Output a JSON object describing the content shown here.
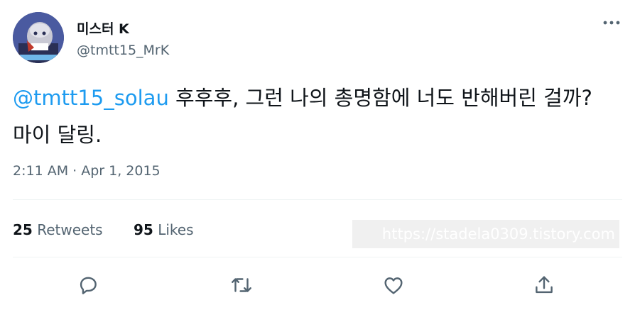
{
  "user": {
    "display_name": "미스터 K",
    "handle": "@tmtt15_MrK",
    "avatar_icon": "avatar-image"
  },
  "tweet": {
    "mention": "@tmtt15_solau",
    "text": " 후후후, 그런 나의 총명함에 너도 반해버린 걸까? 마이 달링.",
    "timestamp": "2:11 AM · Apr 1, 2015"
  },
  "stats": {
    "retweets_count": "25",
    "retweets_label": "Retweets",
    "likes_count": "95",
    "likes_label": "Likes"
  },
  "watermark": "https://stadela0309.tistory.com",
  "actions": {
    "reply_icon": "reply-icon",
    "retweet_icon": "retweet-icon",
    "like_icon": "like-icon",
    "share_icon": "share-icon",
    "more_icon": "more-icon"
  },
  "colors": {
    "accent": "#1d9bf0",
    "text": "#0f1419",
    "secondary": "#536471",
    "divider": "#eff3f4"
  }
}
